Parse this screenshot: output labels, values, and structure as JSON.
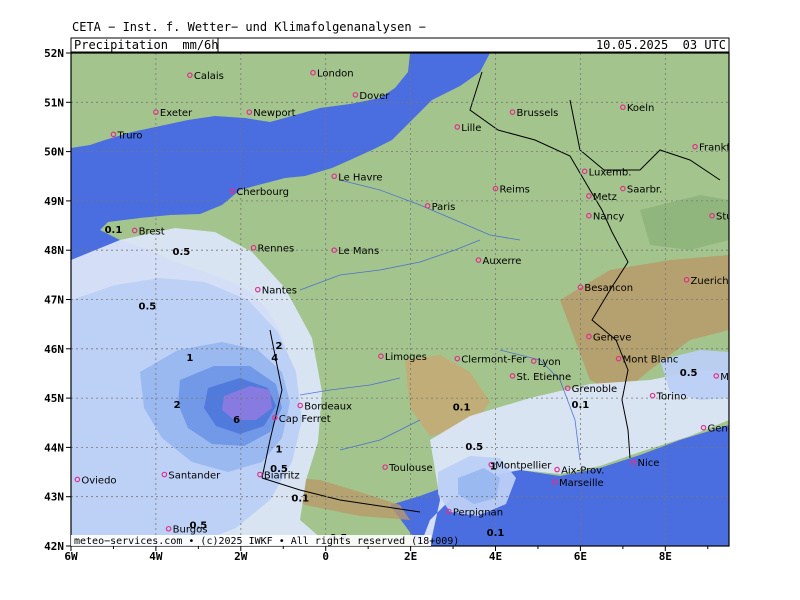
{
  "header": {
    "org": "CETA − Inst. f. Wetter− und Klimafolgenanalysen −",
    "product": "Precipitation  mm/6h",
    "valid": "10.05.2025  03 UTC",
    "footer": "meteo−services.com • (c)2025 IWKF • All rights reserved (18+009)"
  },
  "axes": {
    "lon_labels": [
      "6W",
      "4W",
      "2W",
      "0",
      "2E",
      "4E",
      "6E",
      "8E"
    ],
    "lat_labels": [
      "52N",
      "51N",
      "50N",
      "49N",
      "48N",
      "47N",
      "46N",
      "45N",
      "44N",
      "43N",
      "42N"
    ]
  },
  "cities": [
    {
      "name": "Calais",
      "lon": -3.2,
      "lat": 51.55
    },
    {
      "name": "London",
      "lon": -0.3,
      "lat": 51.6
    },
    {
      "name": "Dover",
      "lon": 0.7,
      "lat": 51.15
    },
    {
      "name": "Exeter",
      "lon": -4.0,
      "lat": 50.8
    },
    {
      "name": "Newport",
      "lon": -1.8,
      "lat": 50.8
    },
    {
      "name": "Truro",
      "lon": -5.0,
      "lat": 50.35
    },
    {
      "name": "Lille",
      "lon": 3.1,
      "lat": 50.5
    },
    {
      "name": "Brussels",
      "lon": 4.4,
      "lat": 50.8
    },
    {
      "name": "Koeln",
      "lon": 7.0,
      "lat": 50.9
    },
    {
      "name": "Frankfurt",
      "lon": 8.7,
      "lat": 50.1
    },
    {
      "name": "Cherbourg",
      "lon": -2.2,
      "lat": 49.2
    },
    {
      "name": "Le Havre",
      "lon": 0.2,
      "lat": 49.5
    },
    {
      "name": "Reims",
      "lon": 4.0,
      "lat": 49.25
    },
    {
      "name": "Luxemb.",
      "lon": 6.1,
      "lat": 49.6
    },
    {
      "name": "Metz",
      "lon": 6.2,
      "lat": 49.1
    },
    {
      "name": "Saarbr.",
      "lon": 7.0,
      "lat": 49.25
    },
    {
      "name": "Paris",
      "lon": 2.4,
      "lat": 48.9
    },
    {
      "name": "Nancy",
      "lon": 6.2,
      "lat": 48.7
    },
    {
      "name": "Stuttgart",
      "lon": 9.1,
      "lat": 48.7
    },
    {
      "name": "Brest",
      "lon": -4.5,
      "lat": 48.4
    },
    {
      "name": "Rennes",
      "lon": -1.7,
      "lat": 48.05
    },
    {
      "name": "Le Mans",
      "lon": 0.2,
      "lat": 48.0
    },
    {
      "name": "Auxerre",
      "lon": 3.6,
      "lat": 47.8
    },
    {
      "name": "Nantes",
      "lon": -1.6,
      "lat": 47.2
    },
    {
      "name": "Besancon",
      "lon": 6.0,
      "lat": 47.25
    },
    {
      "name": "Zuerich",
      "lon": 8.5,
      "lat": 47.4
    },
    {
      "name": "Limoges",
      "lon": 1.3,
      "lat": 45.85
    },
    {
      "name": "Clermont-Fer",
      "lon": 3.1,
      "lat": 45.8
    },
    {
      "name": "Geneve",
      "lon": 6.2,
      "lat": 46.25
    },
    {
      "name": "Lyon",
      "lon": 4.9,
      "lat": 45.75
    },
    {
      "name": "Mont Blanc",
      "lon": 6.9,
      "lat": 45.8
    },
    {
      "name": "St. Etienne",
      "lon": 4.4,
      "lat": 45.45
    },
    {
      "name": "Grenoble",
      "lon": 5.7,
      "lat": 45.2
    },
    {
      "name": "Milano",
      "lon": 9.2,
      "lat": 45.45
    },
    {
      "name": "Bordeaux",
      "lon": -0.6,
      "lat": 44.85
    },
    {
      "name": "Cap Ferret",
      "lon": -1.2,
      "lat": 44.6
    },
    {
      "name": "Torino",
      "lon": 7.7,
      "lat": 45.05
    },
    {
      "name": "Genova",
      "lon": 8.9,
      "lat": 44.4
    },
    {
      "name": "Montpellier",
      "lon": 3.9,
      "lat": 43.65
    },
    {
      "name": "Nice",
      "lon": 7.25,
      "lat": 43.7
    },
    {
      "name": "Toulouse",
      "lon": 1.4,
      "lat": 43.6
    },
    {
      "name": "Aix-Prov.",
      "lon": 5.45,
      "lat": 43.55
    },
    {
      "name": "Marseille",
      "lon": 5.4,
      "lat": 43.3
    },
    {
      "name": "Biarritz",
      "lon": -1.55,
      "lat": 43.45
    },
    {
      "name": "Oviedo",
      "lon": -5.85,
      "lat": 43.35
    },
    {
      "name": "Santander",
      "lon": -3.8,
      "lat": 43.45
    },
    {
      "name": "Perpignan",
      "lon": 2.9,
      "lat": 42.7
    },
    {
      "name": "Burgos",
      "lon": -3.7,
      "lat": 42.35
    }
  ],
  "contour_labels": [
    {
      "text": "0.1",
      "lon": -5.0,
      "lat": 48.35
    },
    {
      "text": "0.5",
      "lon": -3.4,
      "lat": 47.9
    },
    {
      "text": "0.5",
      "lon": -4.2,
      "lat": 46.8
    },
    {
      "text": "1",
      "lon": -3.2,
      "lat": 45.75
    },
    {
      "text": "2",
      "lon": -1.1,
      "lat": 46.0
    },
    {
      "text": "4",
      "lon": -1.2,
      "lat": 45.75
    },
    {
      "text": "6",
      "lon": -2.1,
      "lat": 44.5
    },
    {
      "text": "2",
      "lon": -3.5,
      "lat": 44.8
    },
    {
      "text": "1",
      "lon": -1.1,
      "lat": 43.9
    },
    {
      "text": "0.5",
      "lon": -1.1,
      "lat": 43.5
    },
    {
      "text": "0.1",
      "lon": -0.6,
      "lat": 42.9
    },
    {
      "text": "0.5",
      "lon": -3.0,
      "lat": 42.35
    },
    {
      "text": "0.1",
      "lon": 3.2,
      "lat": 44.75
    },
    {
      "text": "0.5",
      "lon": 3.5,
      "lat": 43.95
    },
    {
      "text": "1",
      "lon": 3.95,
      "lat": 43.55
    },
    {
      "text": "0.5",
      "lon": 8.55,
      "lat": 45.45
    },
    {
      "text": "0.1",
      "lon": 6.0,
      "lat": 44.8
    },
    {
      "text": "0.1",
      "lon": 4.0,
      "lat": 42.2
    },
    {
      "text": "0.5",
      "lon": 0.3,
      "lat": 42.1
    }
  ],
  "colors": {
    "sea": "#4a6de0",
    "land": "#a3c48d",
    "precip_0_1": "#dbe6f8",
    "precip_0_5": "#bcd0f5",
    "precip_1": "#98b7ef",
    "precip_2": "#6f97e6",
    "precip_4": "#4f78dc",
    "precip_6": "#8a7be0",
    "city_dot": "#e0308c",
    "highlight_label": "#11cc33"
  }
}
